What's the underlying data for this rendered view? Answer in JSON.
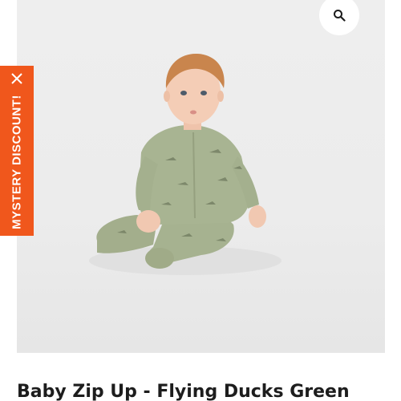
{
  "discount_tab": {
    "label": "MYSTERY DISCOUNT!",
    "close_icon": "close-icon",
    "color": "#f0571c"
  },
  "zoom_button": {
    "icon": "search-icon"
  },
  "product": {
    "image_alt": "Baby wearing a green flying ducks zip up",
    "title": "Baby Zip Up - Flying Ducks Green"
  },
  "colors": {
    "garment": "#a6b290",
    "background": "#ececec",
    "title": "#1d1d1d"
  }
}
